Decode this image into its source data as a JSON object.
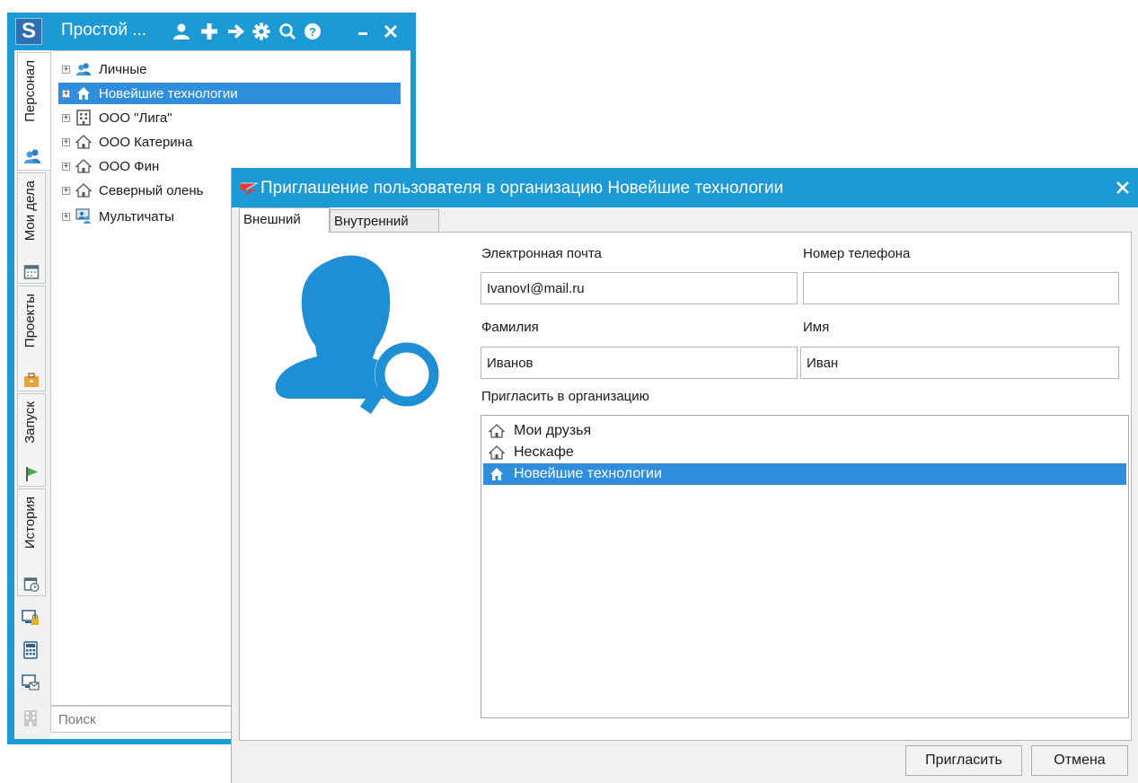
{
  "main_window": {
    "logo_text": "S",
    "title": "Простой ...",
    "toolbar_icons": [
      "user-icon",
      "add-icon",
      "arrow-right-icon",
      "gear-icon",
      "search-icon",
      "help-icon",
      "minimize-icon",
      "close-icon"
    ],
    "side_tabs": [
      {
        "label": "Персонал",
        "icon": "users-icon",
        "active": true
      },
      {
        "label": "Мои дела",
        "icon": "calendar-icon"
      },
      {
        "label": "Проекты",
        "icon": "briefcase-icon"
      },
      {
        "label": "Запуск",
        "icon": "flag-icon"
      },
      {
        "label": "История",
        "icon": "history-icon"
      }
    ],
    "side_buttons": [
      "computer-lock-icon",
      "calculator-icon",
      "computer-mail-icon",
      "building-icon"
    ],
    "tree": [
      {
        "label": "Личные",
        "icon": "users-icon"
      },
      {
        "label": "Новейшие технологии",
        "icon": "home-icon",
        "selected": true
      },
      {
        "label": "ООО \"Лига\"",
        "icon": "building-icon"
      },
      {
        "label": "ООО Катерина",
        "icon": "home-icon"
      },
      {
        "label": "ООО Фин",
        "icon": "home-icon"
      },
      {
        "label": "Северный олень",
        "icon": "home-icon"
      },
      {
        "label": "Мультичаты",
        "icon": "chat-group-icon"
      }
    ],
    "search_placeholder": "Поиск"
  },
  "dialog": {
    "title": "Приглашение пользователя в организацию Новейшие технологии",
    "tabs": [
      {
        "label": "Внешний",
        "active": true
      },
      {
        "label": "Внутренний"
      }
    ],
    "email_label": "Электронная почта",
    "email_value": "IvanovI@mail.ru",
    "phone_label": "Номер телефона",
    "phone_value": "",
    "lastname_label": "Фамилия",
    "lastname_value": "Иванов",
    "firstname_label": "Имя",
    "firstname_value": "Иван",
    "org_label": "Пригласить в организацию",
    "organizations": [
      {
        "label": "Мои друзья",
        "icon": "home-icon"
      },
      {
        "label": "Нескафе",
        "icon": "home-icon"
      },
      {
        "label": "Новейшие технологии",
        "icon": "home-icon",
        "selected": true
      }
    ],
    "invite_button": "Пригласить",
    "cancel_button": "Отмена"
  },
  "colors": {
    "titlebar": "#1b9ad6",
    "selection": "#2f8fdd",
    "avatar": "#1e8fd5"
  }
}
